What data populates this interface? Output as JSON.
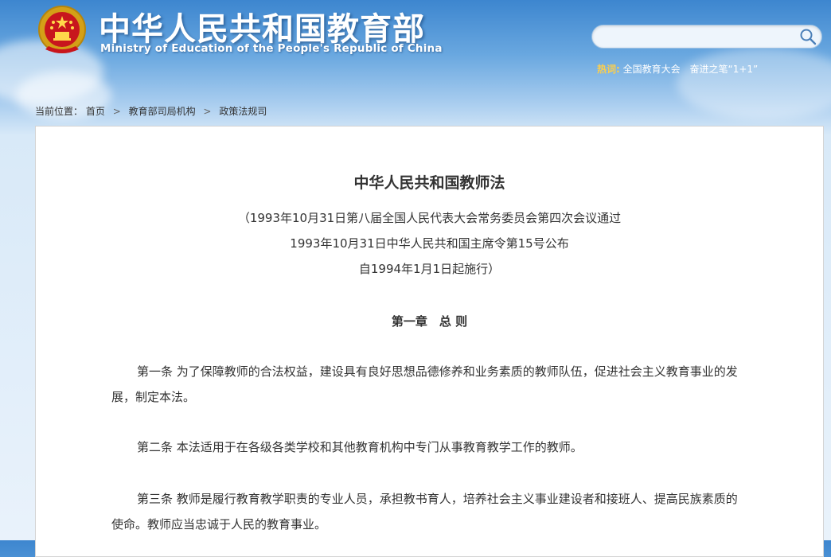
{
  "header": {
    "title_cn": "中华人民共和国教育部",
    "title_en": "Ministry of Education of the People's Republic of China"
  },
  "search": {
    "placeholder": "",
    "value": ""
  },
  "hot": {
    "label": "热词:",
    "links": [
      "全国教育大会",
      "奋进之笔“1+1”"
    ]
  },
  "breadcrumb": {
    "prefix": "当前位置：",
    "items": [
      "首页",
      "教育部司局机构",
      "政策法规司"
    ],
    "separator": ">"
  },
  "document": {
    "title": "中华人民共和国教师法",
    "meta_lines": [
      "（1993年10月31日第八届全国人民代表大会常务委员会第四次会议通过",
      "1993年10月31日中华人民共和国主席令第15号公布",
      "自1994年1月1日起施行）"
    ],
    "chapter": "第一章　总 则",
    "articles": [
      "第一条 为了保障教师的合法权益，建设具有良好思想品德修养和业务素质的教师队伍，促进社会主义教育事业的发展，制定本法。",
      "第二条 本法适用于在各级各类学校和其他教育机构中专门从事教育教学工作的教师。",
      "第三条 教师是履行教育教学职责的专业人员，承担教书育人，培养社会主义事业建设者和接班人、提高民族素质的使命。教师应当忠诚于人民的教育事业。"
    ]
  },
  "colors": {
    "sky_top": "#3d86cf",
    "hot_label": "#ffcf4a",
    "text": "#333333"
  }
}
